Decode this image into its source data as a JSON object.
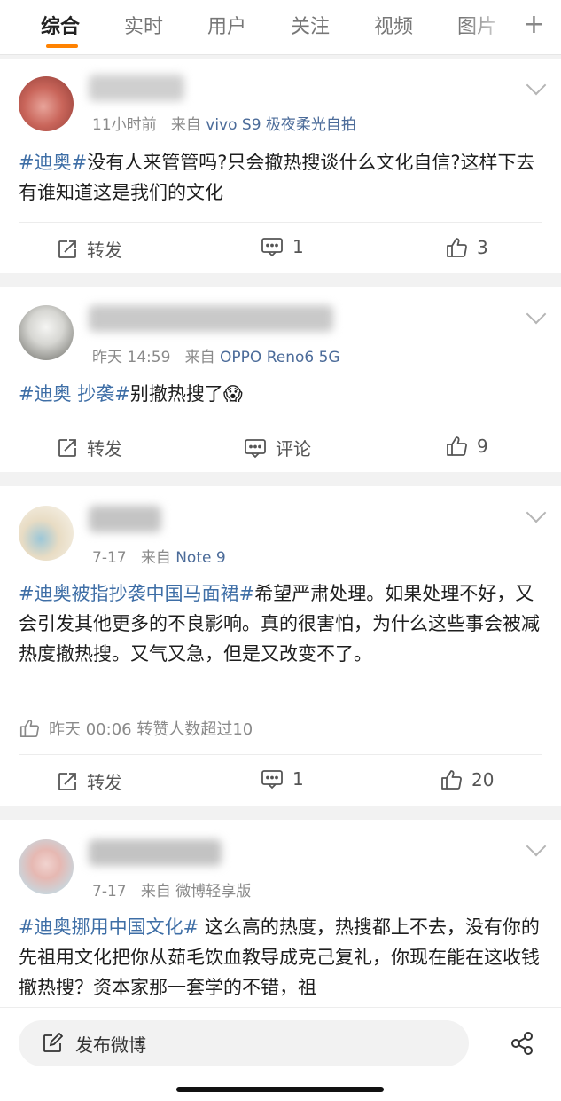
{
  "tabs": [
    {
      "label": "综合",
      "active": true
    },
    {
      "label": "实时",
      "active": false
    },
    {
      "label": "用户",
      "active": false
    },
    {
      "label": "关注",
      "active": false
    },
    {
      "label": "视频",
      "active": false
    },
    {
      "label": "图片",
      "active": false
    }
  ],
  "add_tab_icon": "plus-icon",
  "accent_color": "#ff8200",
  "link_color": "#3e6ea6",
  "posts": [
    {
      "time": "11小时前",
      "source_prefix": "来自",
      "source": "vivo S9 极夜柔光自拍",
      "hashtag": "#迪奥#",
      "text": "没有人来管管吗?只会撤热搜谈什么文化自信?这样下去有谁知道这是我们的文化",
      "repost_label": "转发",
      "comment_label": "1",
      "like_count": "3"
    },
    {
      "time": "昨天 14:59",
      "source_prefix": "来自",
      "source": "OPPO Reno6 5G",
      "hashtag": "#迪奥 抄袭#",
      "text": "别撤热搜了",
      "emoji": "😱",
      "repost_label": "转发",
      "comment_label": "评论",
      "like_count": "9"
    },
    {
      "time": "7-17",
      "source_prefix": "来自",
      "source": "Note 9",
      "hashtag": "#迪奥被指抄袭中国马面裙#",
      "text": "希望严肃处理。如果处理不好，又会引发其他更多的不良影响。真的很害怕，为什么这些事会被减热度撤热搜。又气又急，但是又改变不了。",
      "liked_info": "昨天 00:06 转赞人数超过10",
      "repost_label": "转发",
      "comment_label": "1",
      "like_count": "20"
    },
    {
      "time": "7-17",
      "source_prefix": "来自",
      "source": "微博轻享版",
      "hashtag": "#迪奥挪用中国文化#",
      "text": " 这么高的热度，热搜都上不去，没有你的先祖用文化把你从茹毛饮血教导成克己复礼，你现在能在这收钱撤热搜？资本家那一套学的不错，祖"
    }
  ],
  "bottom": {
    "compose_label": "发布微博",
    "compose_icon": "edit-icon",
    "share_icon": "share-icon"
  }
}
